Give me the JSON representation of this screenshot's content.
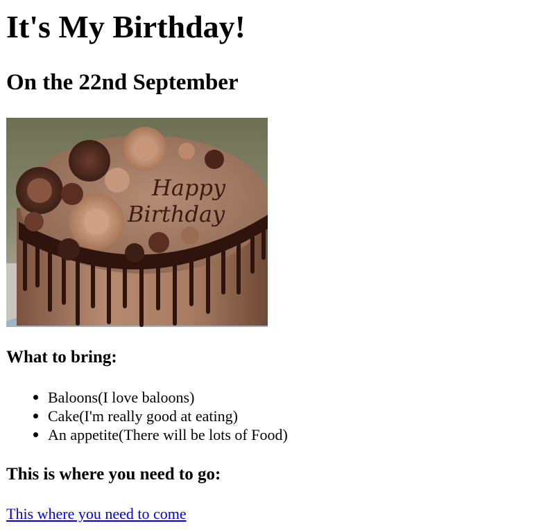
{
  "page": {
    "title": "It's My Birthday!",
    "subtitle": "On the 22nd September"
  },
  "image": {
    "icon": "birthday-cake-image",
    "inscription": "Happy Birthday"
  },
  "bring": {
    "heading": "What to bring:",
    "items": [
      "Baloons(I love baloons)",
      "Cake(I'm really good at eating)",
      "An appetite(There will be lots of Food)"
    ]
  },
  "directions": {
    "heading": "This is where you need to go:",
    "link_text": "This where you need to come"
  },
  "colors": {
    "link": "#0000ee",
    "text": "#000000",
    "background": "#ffffff"
  }
}
